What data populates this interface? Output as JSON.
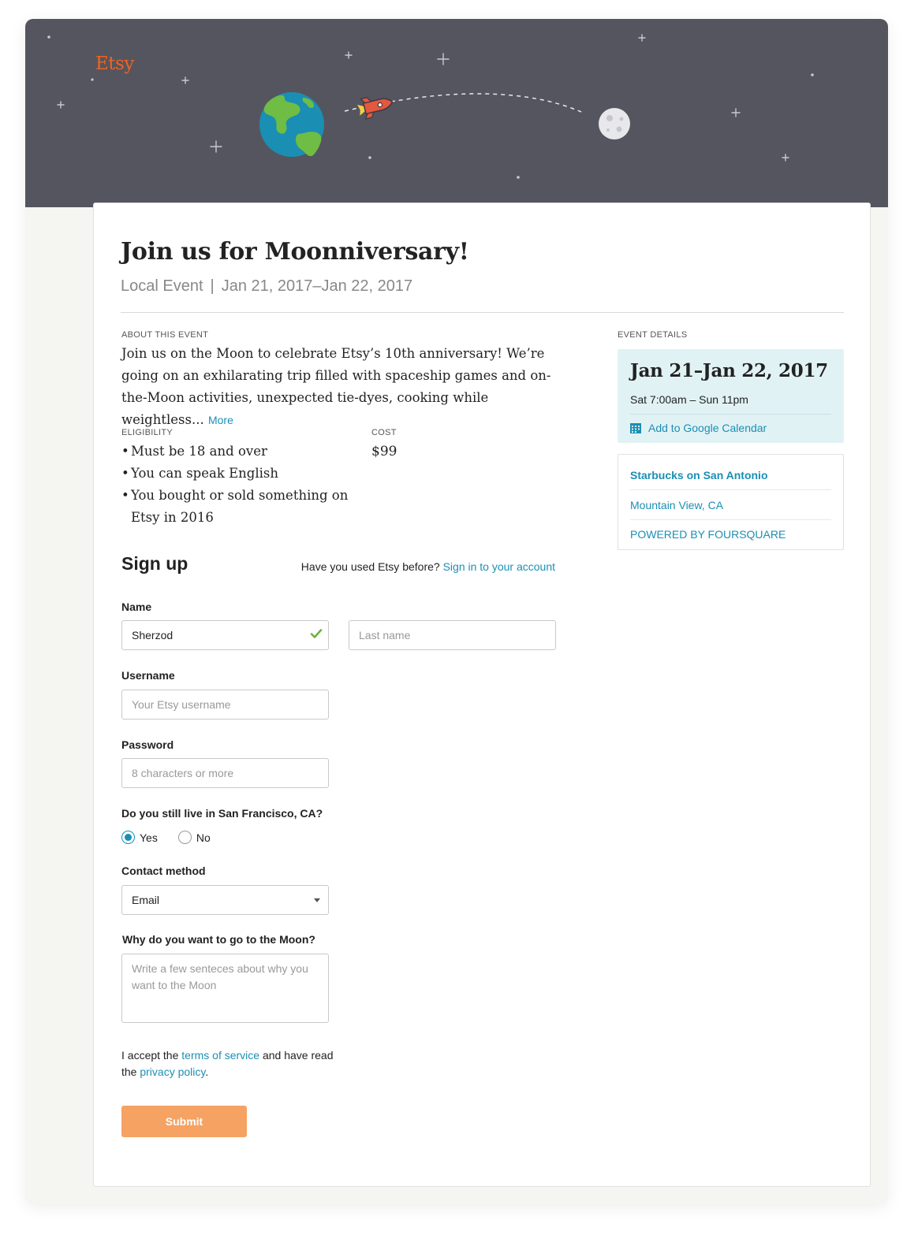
{
  "brand": {
    "logo": "Etsy",
    "accent": "#f1641e",
    "link_color": "#1b8fb3",
    "header_bg": "#55555f",
    "button_color": "#f5a263"
  },
  "event": {
    "title": "Join us for Moonniversary!",
    "type": "Local Event",
    "separator": "|",
    "date_range": "Jan 21, 2017–Jan 22, 2017",
    "about_label": "ABOUT THIS EVENT",
    "about_text": "Join us on the Moon to celebrate Etsy’s 10th anniversary! We’re going on an exhilarating trip filled with spaceship games and on-the-Moon activities, unexpected tie-dyes, cooking while weightless...",
    "more_link": "More",
    "eligibility_label": "ELIGIBILITY",
    "eligibility": [
      "Must be 18 and over",
      "You can speak English",
      "You bought or sold something on Etsy in 2016"
    ],
    "cost_label": "COST",
    "cost": "$99"
  },
  "signup": {
    "title": "Sign up",
    "hint": "Have you used Etsy before?",
    "signin_link": "Sign in to your account",
    "name_label": "Name",
    "first_name_value": "Sherzod",
    "last_name_placeholder": "Last name",
    "username_label": "Username",
    "username_placeholder": "Your Etsy username",
    "password_label": "Password",
    "password_placeholder": "8 characters or more",
    "sf_question": "Do you still live in San Francisco, CA?",
    "yes_label": "Yes",
    "no_label": "No",
    "selected_option": "Yes",
    "contact_label": "Contact method",
    "contact_value": "Email",
    "why_label": "Why do you want to go to the Moon?",
    "why_placeholder": "Write a few senteces about why you want to the Moon",
    "terms_pre": "I accept the ",
    "terms_link": "terms of service",
    "terms_mid": " and have read the ",
    "privacy_link": "privacy policy",
    "terms_end": ".",
    "submit_label": "Submit"
  },
  "details": {
    "label": "EVENT DETAILS",
    "date_title": "Jan 21–Jan 22, 2017",
    "time": "Sat 7:00am – Sun 11pm",
    "calendar_link": "Add to Google Calendar",
    "venue": "Starbucks on San Antonio",
    "city": "Mountain View, CA",
    "powered_by": "POWERED BY FOURSQUARE"
  }
}
